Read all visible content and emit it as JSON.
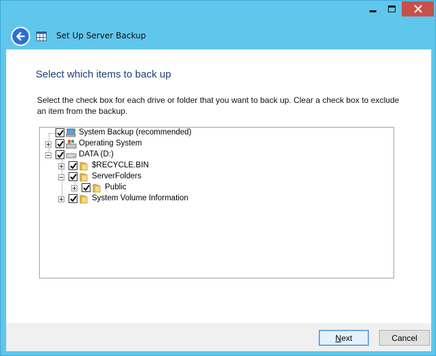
{
  "window": {
    "title": "Set Up Server Backup",
    "controls": [
      "minimize-icon",
      "maximize-icon",
      "close-icon"
    ],
    "accent_color": "#61c6ec",
    "close_color": "#c7504b"
  },
  "page": {
    "heading": "Select which items to back up",
    "instructions": "Select the check box for each drive or folder that you want to back up. Clear a check box to exclude an item from the backup."
  },
  "tree": {
    "items": [
      {
        "label": "System Backup (recommended)",
        "checked": true,
        "icon": "system-backup-icon",
        "expander": "none"
      },
      {
        "label": "Operating System",
        "checked": true,
        "icon": "operating-system-icon",
        "expander": "plus"
      },
      {
        "label": "DATA (D:)",
        "checked": true,
        "icon": "drive-icon",
        "expander": "minus"
      },
      {
        "label": "$RECYCLE.BIN",
        "checked": true,
        "icon": "folder-icon",
        "expander": "plus"
      },
      {
        "label": "ServerFolders",
        "checked": true,
        "icon": "folder-icon",
        "expander": "minus"
      },
      {
        "label": "Public",
        "checked": true,
        "icon": "folder-icon",
        "expander": "plus"
      },
      {
        "label": "System Volume Information",
        "checked": true,
        "icon": "folder-icon",
        "expander": "plus"
      }
    ]
  },
  "footer": {
    "next_label_underlined": "N",
    "next_label_rest": "ext",
    "cancel_label": "Cancel"
  }
}
